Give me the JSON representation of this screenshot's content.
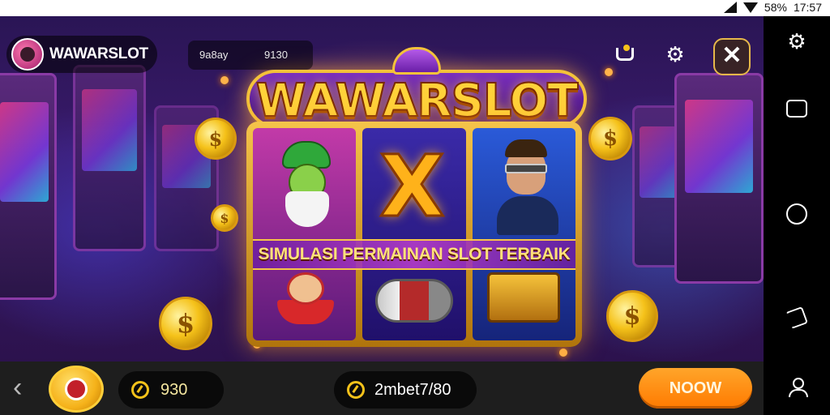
{
  "status_bar": {
    "battery": "58%",
    "time": "17:57"
  },
  "header": {
    "brand": "WAWARSLOT",
    "info_a": "9a8ay",
    "info_b": "9130"
  },
  "game": {
    "title": "WAWARSLOT",
    "banner": "SIMULASI PERMAINAN SLOT TERBAIK",
    "reel_symbols": [
      "elf-icon",
      "x-symbol",
      "man-icon",
      "jester-icon",
      "barrel-icon",
      "chest-icon"
    ]
  },
  "bottom_bar": {
    "stat_1": "930",
    "stat_2": "2mbet7/80",
    "action_label": "NOOW"
  },
  "icons": [
    "cart-icon",
    "gear-icon",
    "close-icon",
    "back-chevron-icon",
    "coin-icon"
  ],
  "colors": {
    "accent": "#ff7a00",
    "gold": "#f5c21a",
    "purple": "#3a1a6b"
  }
}
